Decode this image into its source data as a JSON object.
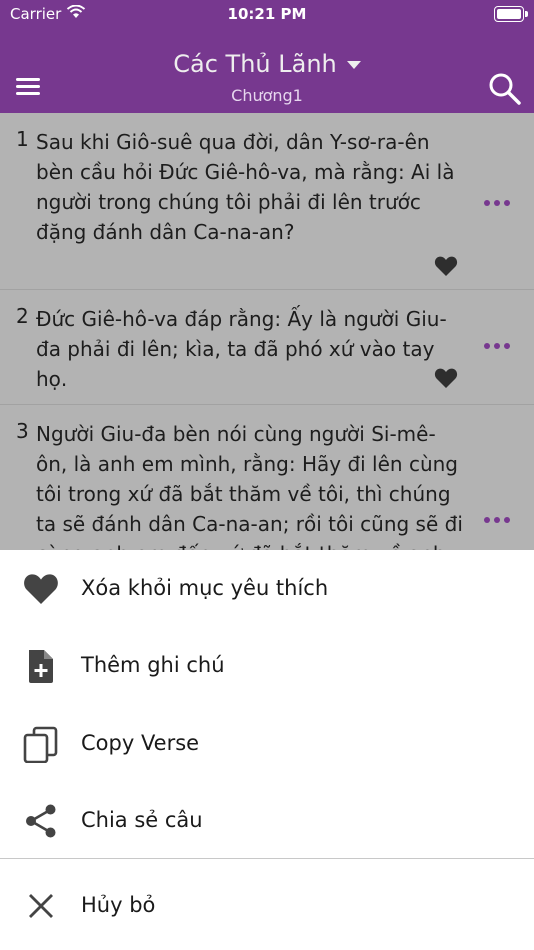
{
  "status_bar": {
    "carrier": "Carrier",
    "time": "10:21 PM"
  },
  "nav": {
    "title": "Các Thủ Lãnh",
    "subtitle": "Chương1"
  },
  "verses": [
    {
      "number": "1",
      "text": "Sau khi Giô-suê qua đời, dân Y-sơ-ra-ên bèn cầu hỏi Đức Giê-hô-va, mà rằng: Ai là người trong chúng tôi phải đi lên trước đặng đánh dân Ca-na-an?",
      "favorite": true
    },
    {
      "number": "2",
      "text": "Đức Giê-hô-va đáp rằng: Ấy là người Giu-đa phải đi lên; kìa, ta đã phó xứ vào tay họ.",
      "favorite": true
    },
    {
      "number": "3",
      "text": "Người Giu-đa bèn nói cùng người Si-mê-ôn, là anh em mình, rằng: Hãy đi lên cùng tôi trong xứ đã bắt thăm về tôi, thì chúng ta sẽ đánh dân Ca-na-an; rồi tôi cũng sẽ đi cùng anh em đến xứ đã bắt thăm về anh",
      "favorite": false
    }
  ],
  "action_sheet": {
    "remove_favorite": "Xóa khỏi mục yêu thích",
    "add_note": "Thêm ghi chú",
    "copy_verse": "Copy Verse",
    "share_verse": "Chia sẻ câu",
    "cancel": "Hủy bỏ"
  },
  "colors": {
    "accent": "#77388f",
    "icon": "#444444"
  }
}
